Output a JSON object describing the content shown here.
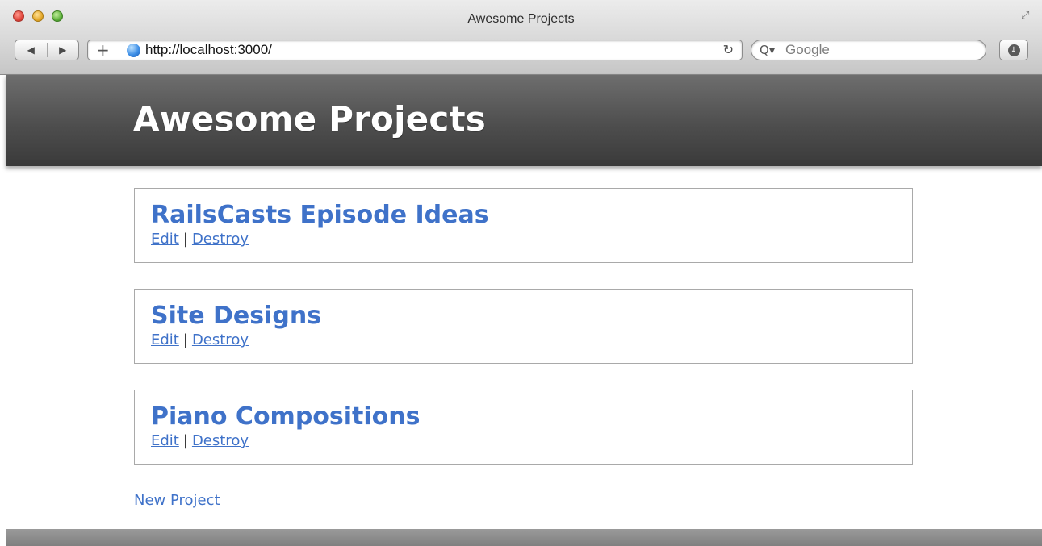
{
  "browser": {
    "window_title": "Awesome Projects",
    "url": "http://localhost:3000/",
    "search_placeholder": "Google",
    "icons": [
      "back-icon",
      "forward-icon",
      "add-bookmark-icon",
      "globe-icon",
      "reload-icon",
      "search-icon",
      "downloads-icon",
      "fullscreen-icon"
    ]
  },
  "page": {
    "title": "Awesome Projects",
    "projects": [
      {
        "name": "RailsCasts Episode Ideas",
        "edit_label": "Edit",
        "separator": "|",
        "destroy_label": "Destroy"
      },
      {
        "name": "Site Designs",
        "edit_label": "Edit",
        "separator": "|",
        "destroy_label": "Destroy"
      },
      {
        "name": "Piano Compositions",
        "edit_label": "Edit",
        "separator": "|",
        "destroy_label": "Destroy"
      }
    ],
    "new_project_label": "New Project",
    "colors": {
      "link": "#3f72c9",
      "header_bg": "#4e4e4e",
      "header_text": "#ffffff"
    }
  }
}
